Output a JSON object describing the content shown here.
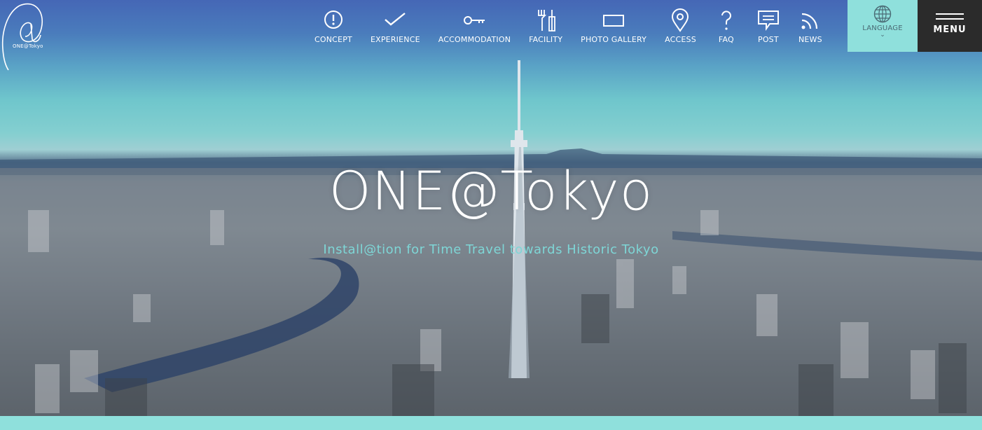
{
  "logo": {
    "text": "ONE@Tokyo"
  },
  "nav": {
    "items": [
      {
        "label": "CONCEPT",
        "icon": "exclamation-circle-icon"
      },
      {
        "label": "EXPERIENCE",
        "icon": "checkmark-icon"
      },
      {
        "label": "ACCOMMODATION",
        "icon": "key-icon"
      },
      {
        "label": "FACILITY",
        "icon": "fork-knife-icon"
      },
      {
        "label": "PHOTO GALLERY",
        "icon": "rectangle-icon"
      },
      {
        "label": "ACCESS",
        "icon": "map-pin-icon"
      },
      {
        "label": "FAQ",
        "icon": "question-mark-icon"
      },
      {
        "label": "POST",
        "icon": "speech-bubble-icon"
      },
      {
        "label": "NEWS",
        "icon": "rss-icon"
      }
    ]
  },
  "language": {
    "label": "LANGUAGE",
    "chevron": "⌄",
    "bg_color": "#8fe0dc"
  },
  "menu": {
    "label": "MENU",
    "bg_color": "#2b2b2b"
  },
  "hero": {
    "title": "ONE@Tokyo",
    "subtitle": "Install@tion for Time Travel towards Historic Tokyo"
  },
  "colors": {
    "accent": "#8fe0dc",
    "subtitle": "#7ed6d6"
  }
}
